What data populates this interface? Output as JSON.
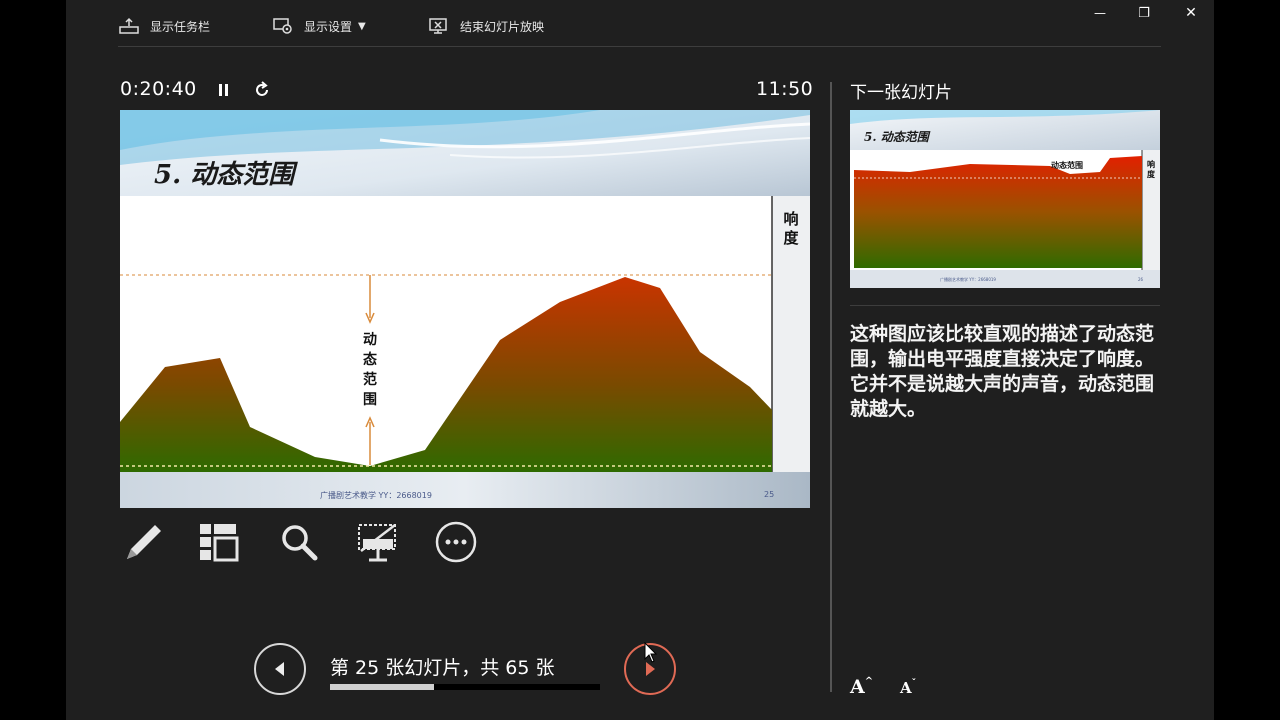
{
  "toolbar": {
    "show_taskbar": "显示任务栏",
    "display_settings": "显示设置",
    "end_slideshow": "结束幻灯片放映"
  },
  "window": {
    "minimize": "—",
    "restore": "❐",
    "close": "✕"
  },
  "presenter": {
    "elapsed_time": "0:20:40",
    "clock": "11:50",
    "next_slide_label": "下一张幻灯片"
  },
  "current_slide": {
    "title": "5.  动态范围",
    "response_label_1": "响",
    "response_label_2": "度",
    "range_label_1": "动",
    "range_label_2": "态",
    "range_label_3": "范",
    "range_label_4": "围",
    "footer_text": "广播剧艺术教学 YY：2668019",
    "page_number": "25"
  },
  "next_slide": {
    "title": "5.  动态范围",
    "range_label": "动态范围",
    "response_label_1": "响",
    "response_label_2": "度",
    "footer_text": "广播剧艺术教学 YY：2668019",
    "page_number": "26"
  },
  "notes": {
    "text": "这种图应该比较直观的描述了动态范围，输出电平强度直接决定了响度。它并不是说越大声的声音，动态范围就越大。"
  },
  "navigation": {
    "slide_counter": "第 25 张幻灯片，共 65 张",
    "current_slide_number": 25,
    "total_slides": 65,
    "progress_fraction": 0.385
  },
  "font_controls": {
    "increase": "A",
    "decrease": "A"
  },
  "colors": {
    "background": "#1f1f1f",
    "accent_next": "#e06a55",
    "chart_top": "#c02a00",
    "chart_bottom": "#2e6a00"
  }
}
